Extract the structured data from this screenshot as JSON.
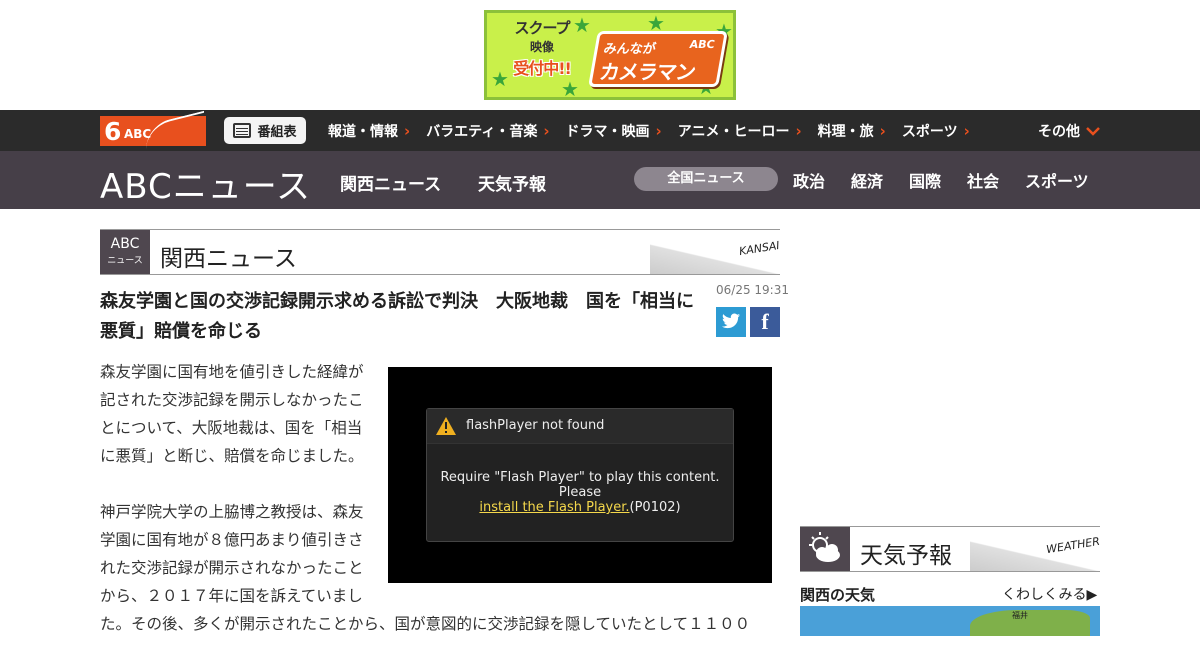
{
  "ad_banner": {
    "line1": "スクープ",
    "line2": "映像",
    "line3": "受付中!!",
    "brand_top": "みんなが",
    "brand_main": "カメラマン",
    "brand_abc": "ABC"
  },
  "global_nav": {
    "logo_six": "6",
    "logo_abc": "ABC",
    "program_guide_label": "番組表",
    "items": [
      {
        "label": "報道・情報",
        "chevron": "›"
      },
      {
        "label": "バラエティ・音楽",
        "chevron": "›"
      },
      {
        "label": "ドラマ・映画",
        "chevron": "›"
      },
      {
        "label": "アニメ・ヒーロー",
        "chevron": "›"
      },
      {
        "label": "料理・旅",
        "chevron": "›"
      },
      {
        "label": "スポーツ",
        "chevron": "›"
      }
    ],
    "more_label": "その他",
    "accent_color": "#e8501e"
  },
  "news_header": {
    "logo_text": "ABCニュース",
    "links": [
      "関西ニュース",
      "天気予報"
    ],
    "active_pill": "全国ニュース",
    "categories": [
      "政治",
      "経済",
      "国際",
      "社会",
      "スポーツ"
    ]
  },
  "section": {
    "badge_line1": "ABC",
    "badge_line2": "ニュース",
    "title": "関西ニュース",
    "english": "KANSAI"
  },
  "article": {
    "title": "森友学園と国の交渉記録開示求める訴訟で判決　大阪地裁　国を「相当に悪質」賠償を命じる",
    "date": "06/25 19:31",
    "paragraphs": [
      "森友学園に国有地を値引きした経緯が記された交渉記録を開示しなかったことについて、大阪地裁は、国を「相当に悪質」と断じ、賠償を命じました。",
      "神戸学院大学の上脇博之教授は、森友学園に国有地が８億円あまり値引きされた交渉記録が開示されなかったことから、２０１７年に国を訴えていました。その後、多くが開示されたことから、国が意図的に交渉記録を隠していたとして１１００"
    ]
  },
  "video": {
    "error_title": "flashPlayer not found",
    "message_line1": "Require \"Flash Player\" to play this content.",
    "message_line2": "Please",
    "install_link": "install the Flash Player.",
    "error_code": "(P0102)"
  },
  "weather": {
    "title": "天気予報",
    "english": "WEATHER",
    "subtitle": "関西の天気",
    "more_link": "くわしくみる▶",
    "map_city": "福井"
  }
}
